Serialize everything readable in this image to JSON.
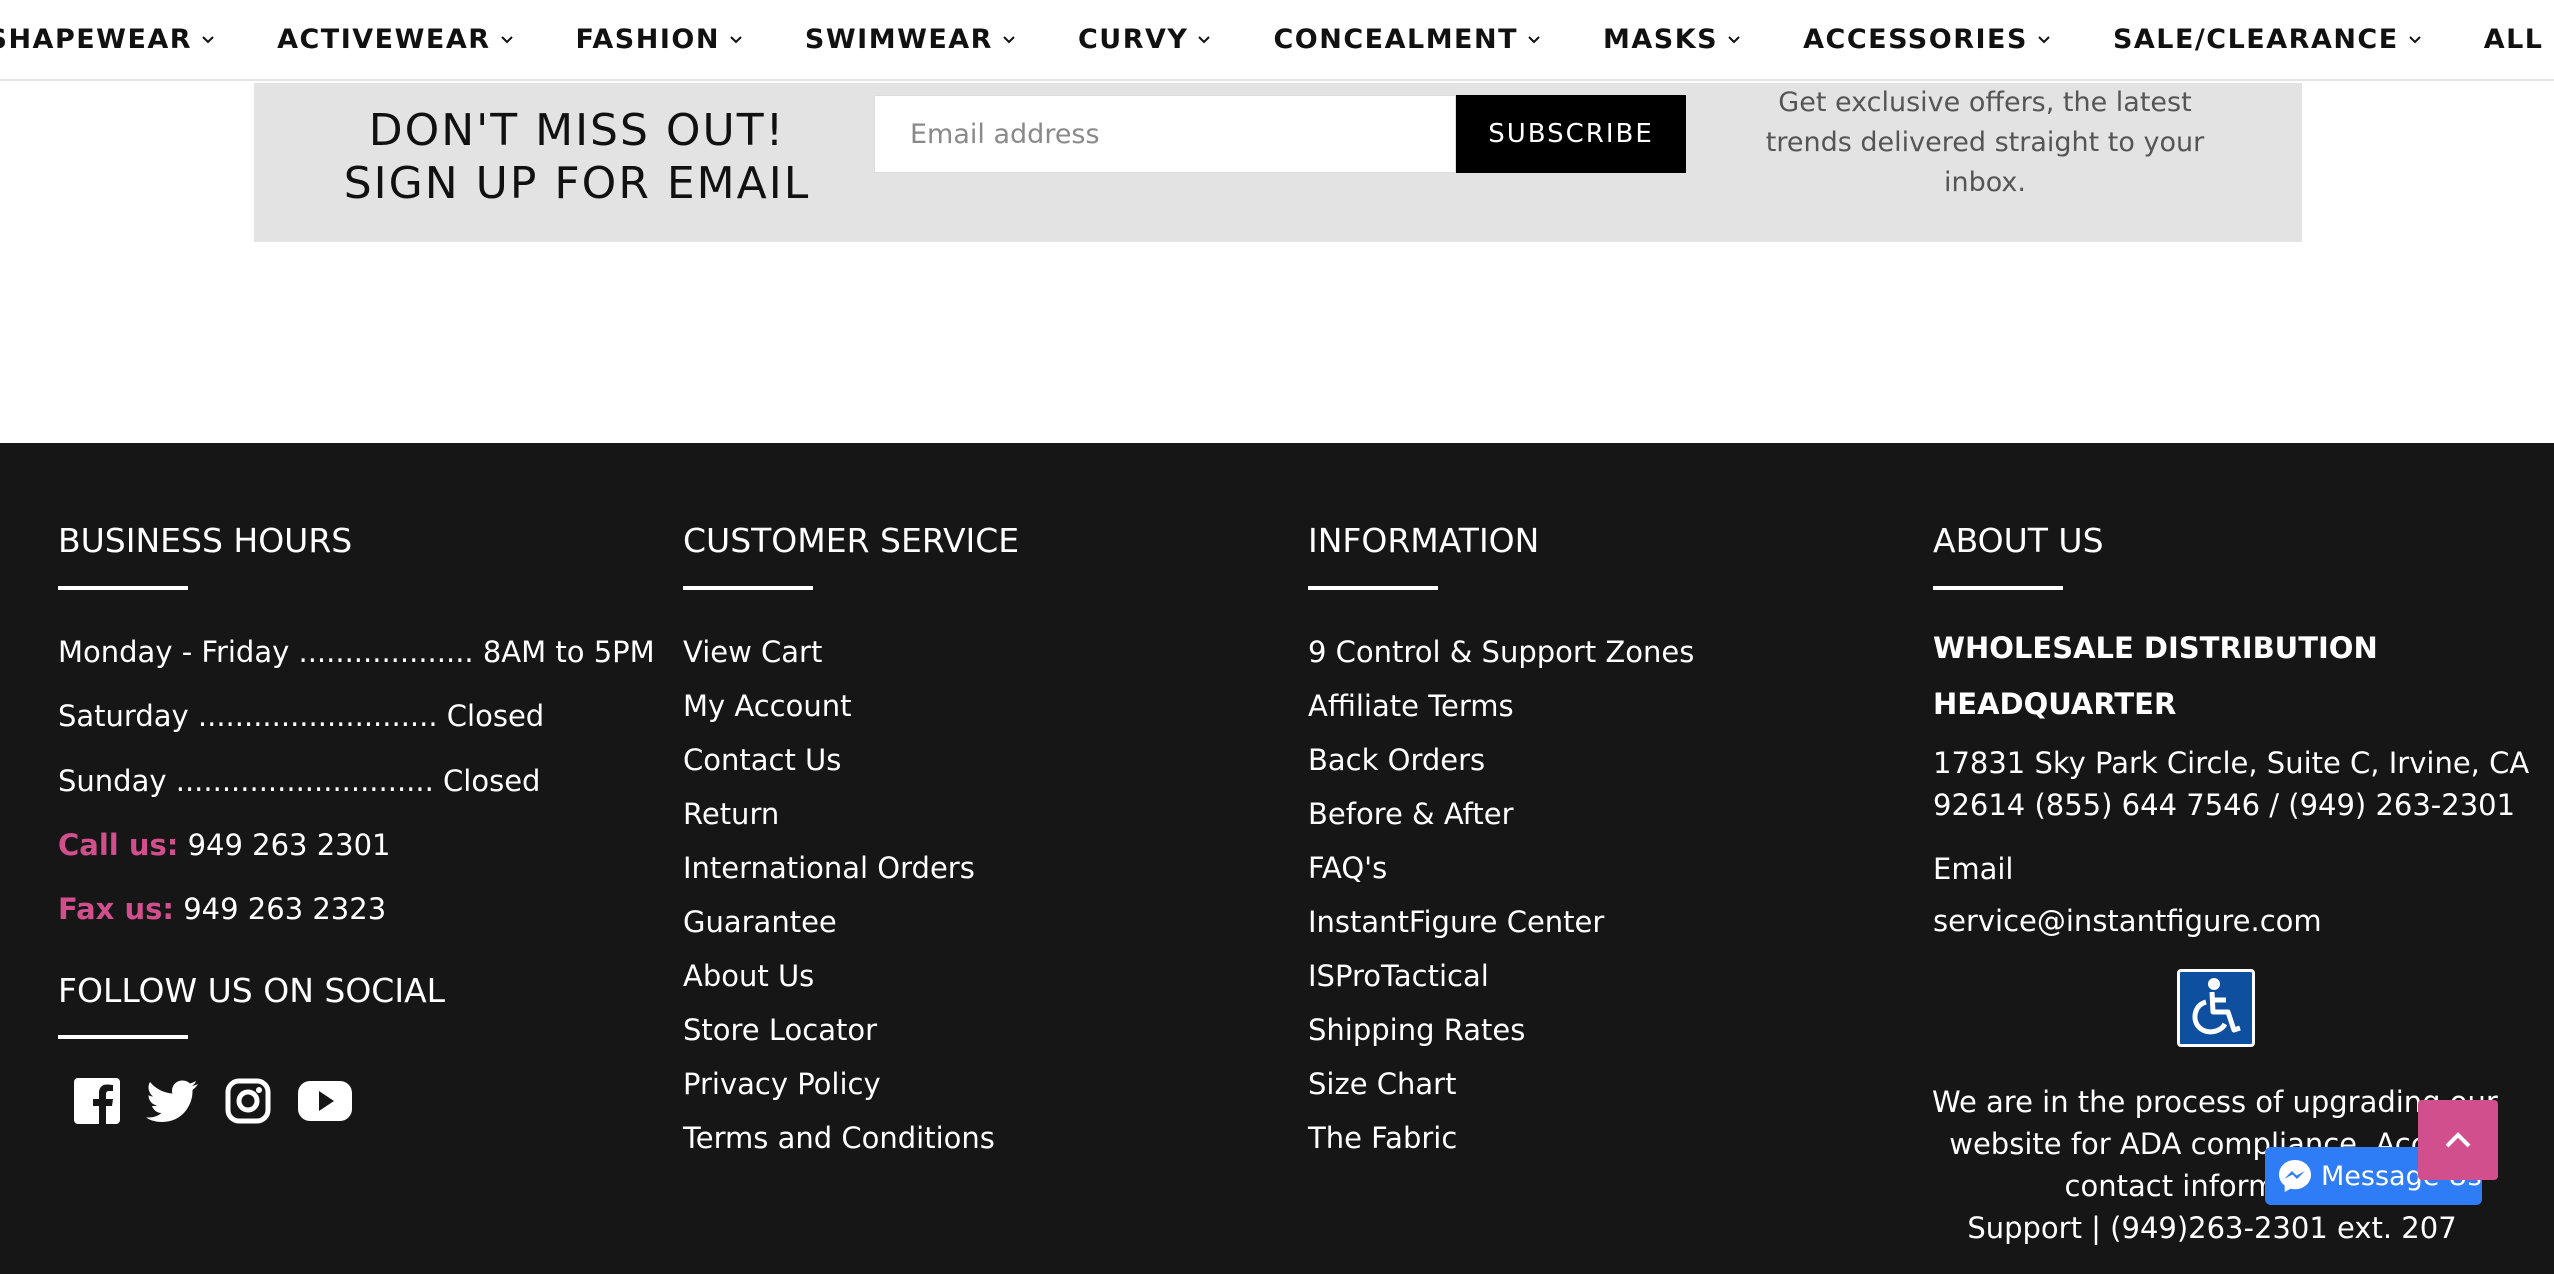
{
  "nav": {
    "items": [
      {
        "label": "SHAPEWEAR"
      },
      {
        "label": "ACTIVEWEAR"
      },
      {
        "label": "FASHION"
      },
      {
        "label": "SWIMWEAR"
      },
      {
        "label": "CURVY"
      },
      {
        "label": "CONCEALMENT"
      },
      {
        "label": "MASKS"
      },
      {
        "label": "ACCESSORIES"
      },
      {
        "label": "SALE/CLEARANCE"
      },
      {
        "label": "ALL"
      }
    ]
  },
  "newsletter": {
    "heading_line1": "DON'T MISS OUT!",
    "heading_line2": "SIGN UP FOR EMAIL",
    "email_placeholder": "Email address",
    "subscribe_label": "SUBSCRIBE",
    "blurb_line1": "Get exclusive offers, the latest",
    "blurb_line2": "trends delivered straight to your",
    "blurb_line3": "inbox."
  },
  "footer": {
    "business_hours": {
      "title": "BUSINESS HOURS",
      "weekday": "Monday - Friday ................... 8AM to 5PM",
      "saturday": "Saturday .......................... Closed",
      "sunday": "Sunday ............................ Closed",
      "call_label": "Call us:",
      "call_number": "949 263 2301",
      "fax_label": "Fax us:",
      "fax_number": "949 263 2323",
      "social_title": "FOLLOW US ON SOCIAL",
      "social_icons": [
        "facebook-icon",
        "twitter-icon",
        "instagram-icon",
        "youtube-icon"
      ]
    },
    "customer_service": {
      "title": "CUSTOMER SERVICE",
      "links": [
        "View Cart",
        "My Account",
        "Contact Us",
        "Return",
        "International Orders",
        "Guarantee",
        "About Us",
        "Store Locator",
        "Privacy Policy",
        "Terms and Conditions"
      ]
    },
    "information": {
      "title": "INFORMATION",
      "links": [
        "9 Control & Support Zones",
        "Affiliate Terms",
        "Back Orders",
        "Before & After",
        "FAQ's",
        "InstantFigure Center",
        "ISProTactical",
        "Shipping Rates",
        "Size Chart",
        "The Fabric"
      ]
    },
    "about": {
      "title": "ABOUT US",
      "hq_line1": "WHOLESALE DISTRIBUTION",
      "hq_line2": "HEADQUARTER",
      "address_line1": "17831 Sky Park Circle, Suite C, Irvine, CA",
      "address_line2": "92614 (855) 644 7546 / (949) 263-2301",
      "email_label": "Email",
      "email": "service@instantfigure.com",
      "ada_line1": "We are in the process of upgrading our",
      "ada_line2": "website for ADA compliance. Access",
      "ada_line3": "contact information:",
      "ada_line4": "Support | (949)263-2301 ext. 207"
    }
  },
  "widgets": {
    "messenger_label": "Message Us"
  },
  "colors": {
    "accent_pink": "#d24f8d",
    "footer_bg": "#161616",
    "newsletter_bg": "#e3e3e3",
    "messenger_blue": "#2f7df6"
  }
}
